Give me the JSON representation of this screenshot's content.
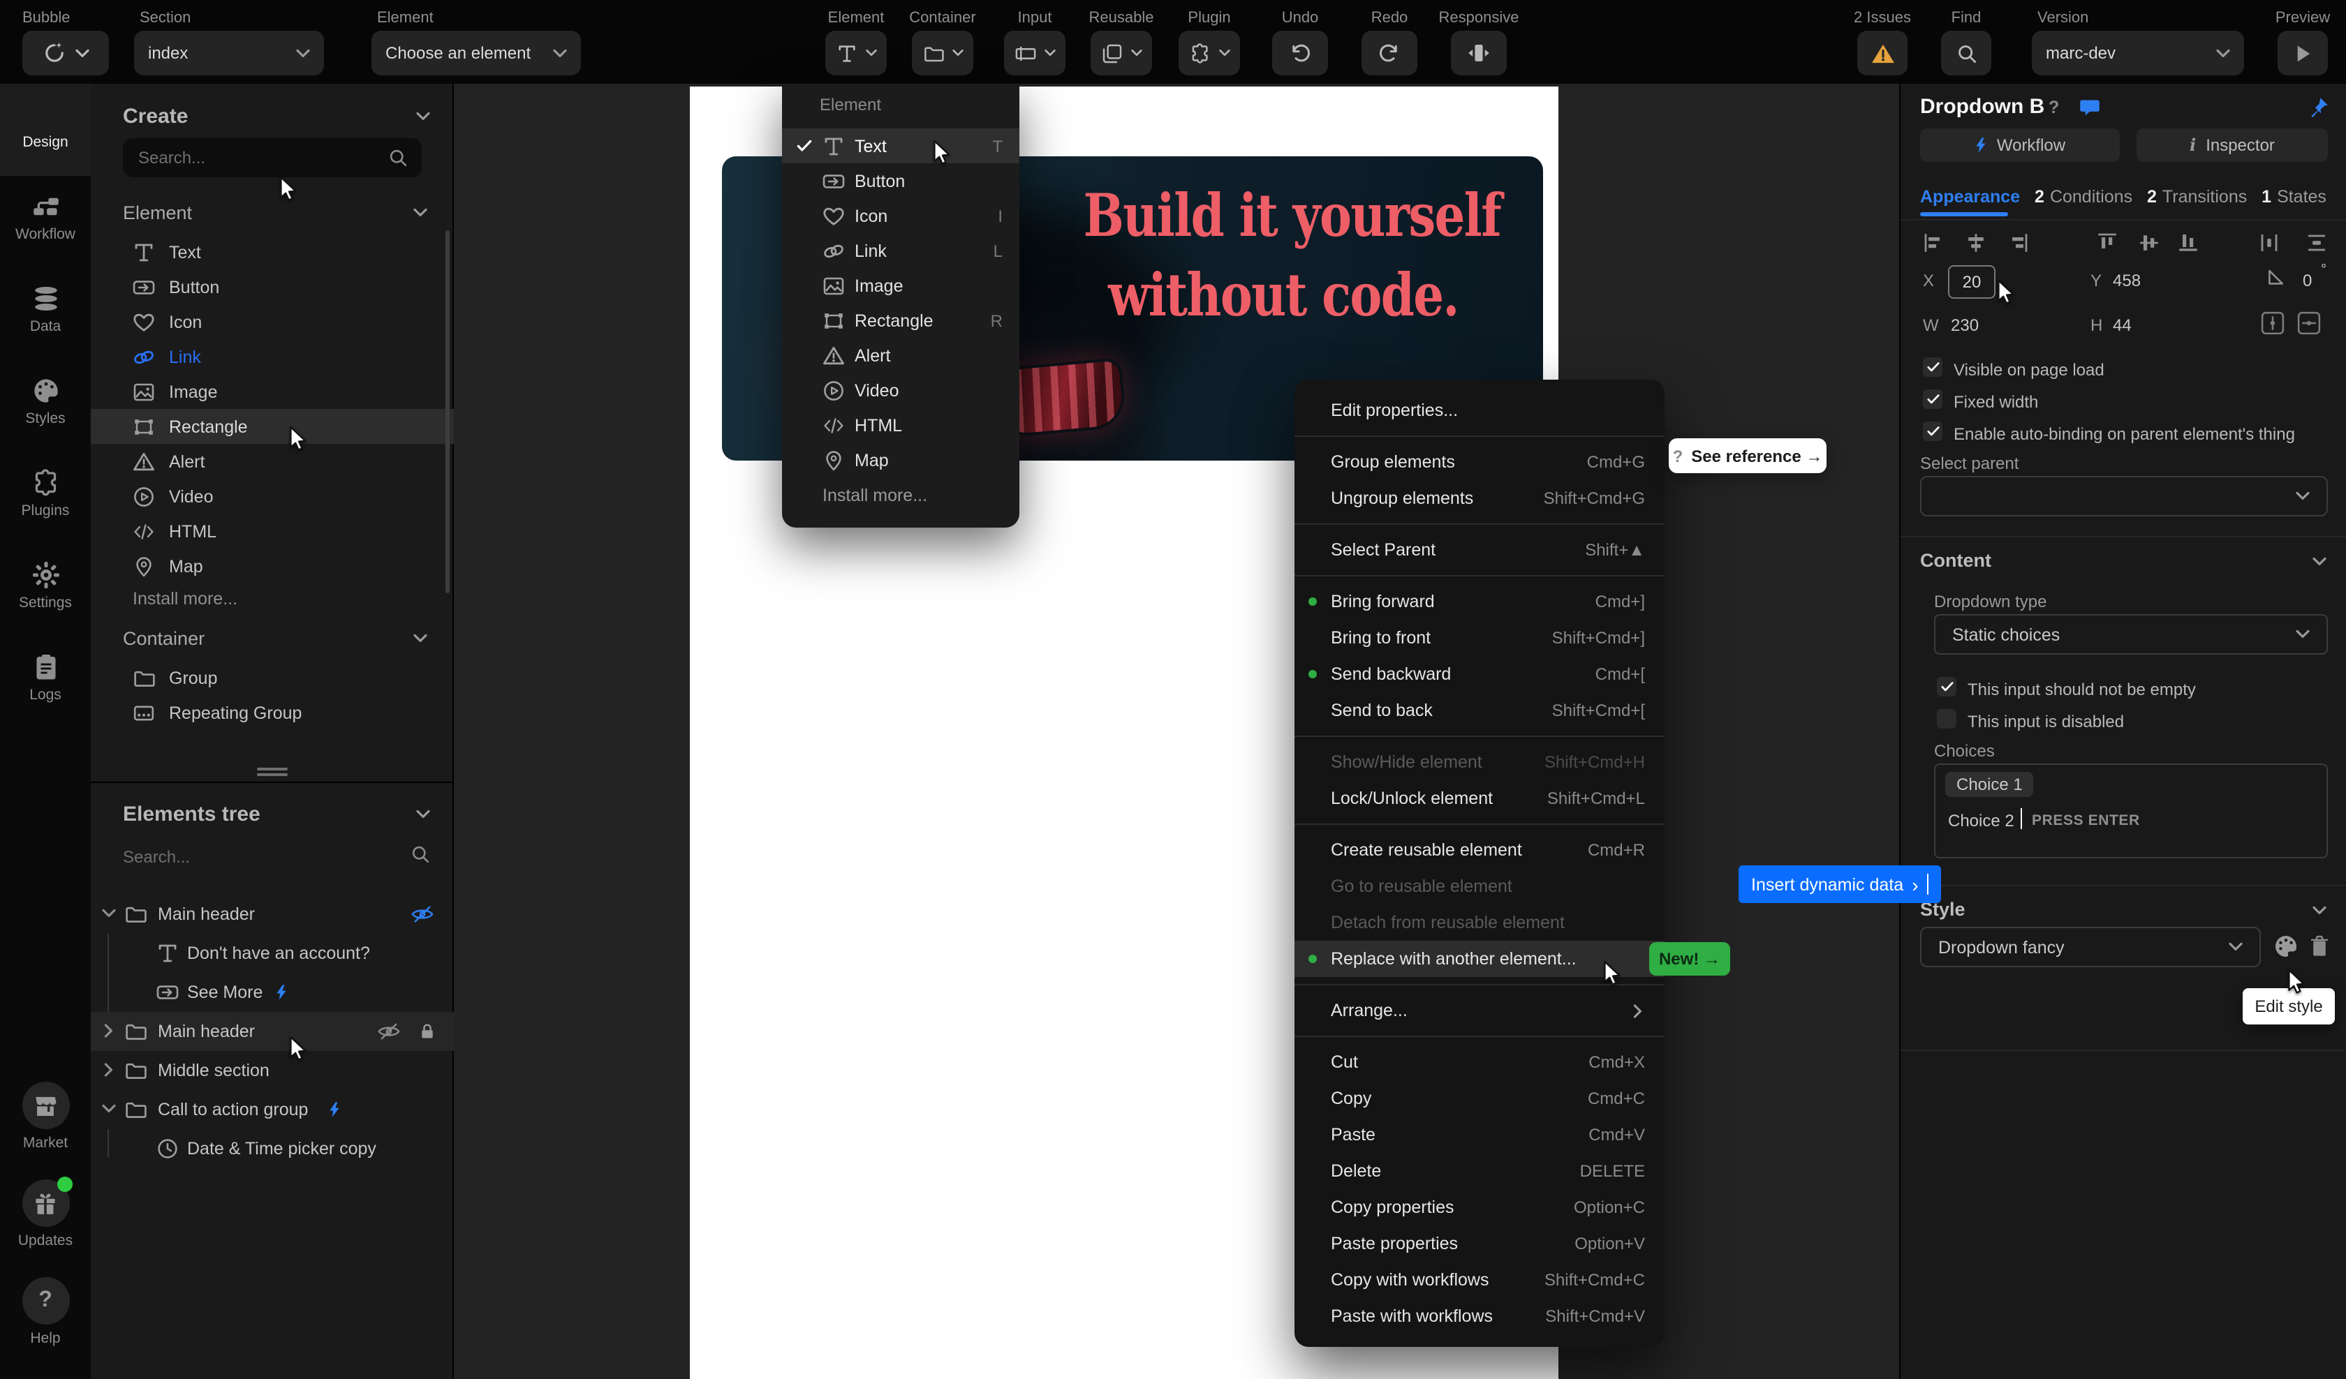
{
  "toolbar": {
    "bubble_label": "Bubble",
    "section_label": "Section",
    "section_value": "index",
    "element_label": "Element",
    "element_value": "Choose an element",
    "tools": {
      "element": "Element",
      "container": "Container",
      "input": "Input",
      "reusable": "Reusable",
      "plugin": "Plugin",
      "undo": "Undo",
      "redo": "Redo",
      "responsive": "Responsive"
    },
    "issues_label": "2 Issues",
    "find_label": "Find",
    "version_label": "Version",
    "version_value": "marc-dev",
    "preview_label": "Preview"
  },
  "rail": {
    "design": "Design",
    "workflow": "Workflow",
    "data": "Data",
    "styles": "Styles",
    "plugins": "Plugins",
    "settings": "Settings",
    "logs": "Logs",
    "market": "Market",
    "updates": "Updates",
    "help": "Help"
  },
  "create": {
    "title": "Create",
    "search_placeholder": "Search...",
    "element_section": "Element",
    "items": [
      {
        "label": "Text"
      },
      {
        "label": "Button"
      },
      {
        "label": "Icon"
      },
      {
        "label": "Link"
      },
      {
        "label": "Image"
      },
      {
        "label": "Rectangle"
      },
      {
        "label": "Alert"
      },
      {
        "label": "Video"
      },
      {
        "label": "HTML"
      },
      {
        "label": "Map"
      }
    ],
    "install_more": "Install more...",
    "container_section": "Container",
    "container_items": [
      {
        "label": "Group"
      },
      {
        "label": "Repeating Group"
      }
    ]
  },
  "tree": {
    "title": "Elements tree",
    "search_placeholder": "Search...",
    "rows": [
      {
        "label": "Main header"
      },
      {
        "label": "Don't have an account?"
      },
      {
        "label": "See More"
      },
      {
        "label": "Main header"
      },
      {
        "label": "Middle section"
      },
      {
        "label": "Call to action group"
      },
      {
        "label": "Date & Time picker copy"
      }
    ]
  },
  "canvas": {
    "headline_line1": "Build it yourself",
    "headline_line2": "without code.",
    "headline_color": "#ee5e66"
  },
  "element_menu": {
    "title": "Element",
    "items": [
      {
        "label": "Text",
        "shortcut": "T"
      },
      {
        "label": "Button",
        "shortcut": ""
      },
      {
        "label": "Icon",
        "shortcut": "I"
      },
      {
        "label": "Link",
        "shortcut": "L"
      },
      {
        "label": "Image",
        "shortcut": ""
      },
      {
        "label": "Rectangle",
        "shortcut": "R"
      },
      {
        "label": "Alert",
        "shortcut": ""
      },
      {
        "label": "Video",
        "shortcut": ""
      },
      {
        "label": "HTML",
        "shortcut": ""
      },
      {
        "label": "Map",
        "shortcut": ""
      }
    ],
    "install_more": "Install more..."
  },
  "context_menu": {
    "items": [
      {
        "label": "Edit properties...",
        "shortcut": ""
      },
      {
        "label": "Group elements",
        "shortcut": "Cmd+G"
      },
      {
        "label": "Ungroup elements",
        "shortcut": "Shift+Cmd+G"
      },
      {
        "label": "Select Parent",
        "shortcut": "Shift+▲"
      },
      {
        "label": "Bring forward",
        "shortcut": "Cmd+]"
      },
      {
        "label": "Bring to front",
        "shortcut": "Shift+Cmd+]"
      },
      {
        "label": "Send backward",
        "shortcut": "Cmd+["
      },
      {
        "label": "Send to back",
        "shortcut": "Shift+Cmd+["
      },
      {
        "label": "Show/Hide element",
        "shortcut": "Shift+Cmd+H"
      },
      {
        "label": "Lock/Unlock element",
        "shortcut": "Shift+Cmd+L"
      },
      {
        "label": "Create reusable element",
        "shortcut": "Cmd+R"
      },
      {
        "label": "Go to reusable element",
        "shortcut": ""
      },
      {
        "label": "Detach from reusable element",
        "shortcut": ""
      },
      {
        "label": "Replace with another element...",
        "shortcut": ""
      },
      {
        "label": "Arrange...",
        "shortcut": ""
      },
      {
        "label": "Cut",
        "shortcut": "Cmd+X"
      },
      {
        "label": "Copy",
        "shortcut": "Cmd+C"
      },
      {
        "label": "Paste",
        "shortcut": "Cmd+V"
      },
      {
        "label": "Delete",
        "shortcut": "DELETE"
      },
      {
        "label": "Copy properties",
        "shortcut": "Option+C"
      },
      {
        "label": "Paste properties",
        "shortcut": "Option+V"
      },
      {
        "label": "Copy with workflows",
        "shortcut": "Shift+Cmd+C"
      },
      {
        "label": "Paste with workflows",
        "shortcut": "Shift+Cmd+V"
      }
    ],
    "new_badge": "New! →"
  },
  "floats": {
    "see_reference_q": "?",
    "see_reference": "See reference →",
    "insert_dynamic": "Insert dynamic data",
    "insert_dynamic_arrow": "›",
    "edit_style_tooltip": "Edit style"
  },
  "inspector": {
    "title": "Dropdown B",
    "help": "?",
    "workflow_btn": "Workflow",
    "inspector_btn": "Inspector",
    "tabs": [
      {
        "count": "",
        "label": "Appearance"
      },
      {
        "count": "2",
        "label": "Conditions"
      },
      {
        "count": "2",
        "label": "Transitions"
      },
      {
        "count": "1",
        "label": "States"
      }
    ],
    "x_label": "X",
    "x_value": "20",
    "y_label": "Y",
    "y_value": "458",
    "angle_value": "0",
    "degree": "°",
    "w_label": "W",
    "w_value": "230",
    "h_label": "H",
    "h_value": "44",
    "check_visible": "Visible on page load",
    "check_fixed": "Fixed width",
    "check_autobind": "Enable auto-binding on parent element's thing",
    "select_parent_label": "Select parent",
    "content_title": "Content",
    "dropdown_type_label": "Dropdown type",
    "dropdown_type_value": "Static choices",
    "check_not_empty": "This input should not be empty",
    "check_disabled": "This input is disabled",
    "choices_label": "Choices",
    "choice_1": "Choice 1",
    "choice_2": "Choice 2",
    "press_enter": "PRESS ENTER",
    "style_title": "Style",
    "style_value": "Dropdown fancy"
  },
  "colors": {
    "accent_blue": "#2e7ff2",
    "green": "#2fae43",
    "warning": "#e6a23c",
    "headline": "#ee5e66"
  }
}
